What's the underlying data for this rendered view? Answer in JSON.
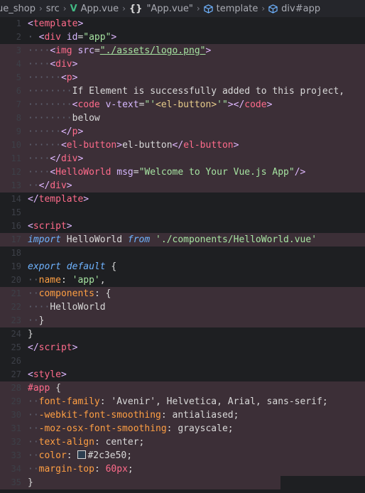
{
  "breadcrumb": {
    "items": [
      "ue_shop",
      "src",
      "App.vue",
      "\"App.vue\"",
      "template",
      "div#app"
    ],
    "sep": "›",
    "vue_glyph": "V",
    "braces_glyph": "{}"
  },
  "gutter_numbers": [
    "1",
    "2",
    "3",
    "4",
    "5",
    "6",
    "7",
    "8",
    "9",
    "10",
    "11",
    "12",
    "13",
    "14",
    "15",
    "16",
    "17",
    "18",
    "19",
    "20",
    "21",
    "22",
    "23",
    "24",
    "25",
    "26",
    "27",
    "28",
    "29",
    "30",
    "31",
    "32",
    "33",
    "34",
    "35"
  ],
  "code": {
    "l1": {
      "lt": "<",
      "tag": "template",
      "gt": ">"
    },
    "l2": {
      "tag": "div",
      "attr": "id",
      "val": "\"app\""
    },
    "l3": {
      "tag": "img",
      "attr": "src",
      "val": "\"./assets/logo.png\""
    },
    "l4": {
      "tag": "div"
    },
    "l5": {
      "tag": "p"
    },
    "l6": {
      "text": "If Element is successfully added to this project,"
    },
    "l7": {
      "tag": "code",
      "attr": "v-text",
      "q1": "\"'",
      "inner": "<el-button>",
      "q2": "'\"",
      "close": "code"
    },
    "l8": {
      "text": "below"
    },
    "l9": {
      "close": "p"
    },
    "l10": {
      "tag": "el-button",
      "inner": "el-button",
      "close": "el-button"
    },
    "l11": {
      "close": "div"
    },
    "l12": {
      "tag": "HelloWorld",
      "attr": "msg",
      "val": "\"Welcome to Your Vue.js App\""
    },
    "l13": {
      "close": "div"
    },
    "l14": {
      "close": "template"
    },
    "l16": {
      "tag": "script"
    },
    "l17": {
      "kw1": "import",
      "name": "HelloWorld",
      "kw2": "from",
      "path": "'./components/HelloWorld.vue'"
    },
    "l19": {
      "kw1": "export",
      "kw2": "default",
      "brace": "{"
    },
    "l20": {
      "prop": "name",
      "val": "'app'"
    },
    "l21": {
      "prop": "components",
      "brace": "{"
    },
    "l22": {
      "name": "HelloWorld"
    },
    "l23": {
      "brace": "}"
    },
    "l24": {
      "brace": "}"
    },
    "l25": {
      "close": "script"
    },
    "l27": {
      "tag": "style"
    },
    "l28": {
      "sel": "#app",
      "brace": "{"
    },
    "l29": {
      "prop": "font-family",
      "val": "'Avenir', Helvetica, Arial, sans-serif;"
    },
    "l30": {
      "prop": "-webkit-font-smoothing",
      "val": "antialiased;"
    },
    "l31": {
      "prop": "-moz-osx-font-smoothing",
      "val": "grayscale;"
    },
    "l32": {
      "prop": "text-align",
      "val": "center;"
    },
    "l33": {
      "prop": "color",
      "val": "#2c3e50;"
    },
    "l34": {
      "prop": "margin-top",
      "num": "60px",
      "semi": ";"
    },
    "l35": {
      "brace": "}"
    }
  },
  "colors": {
    "highlight": "#3c2f37",
    "swatch": "#2c3e50"
  }
}
